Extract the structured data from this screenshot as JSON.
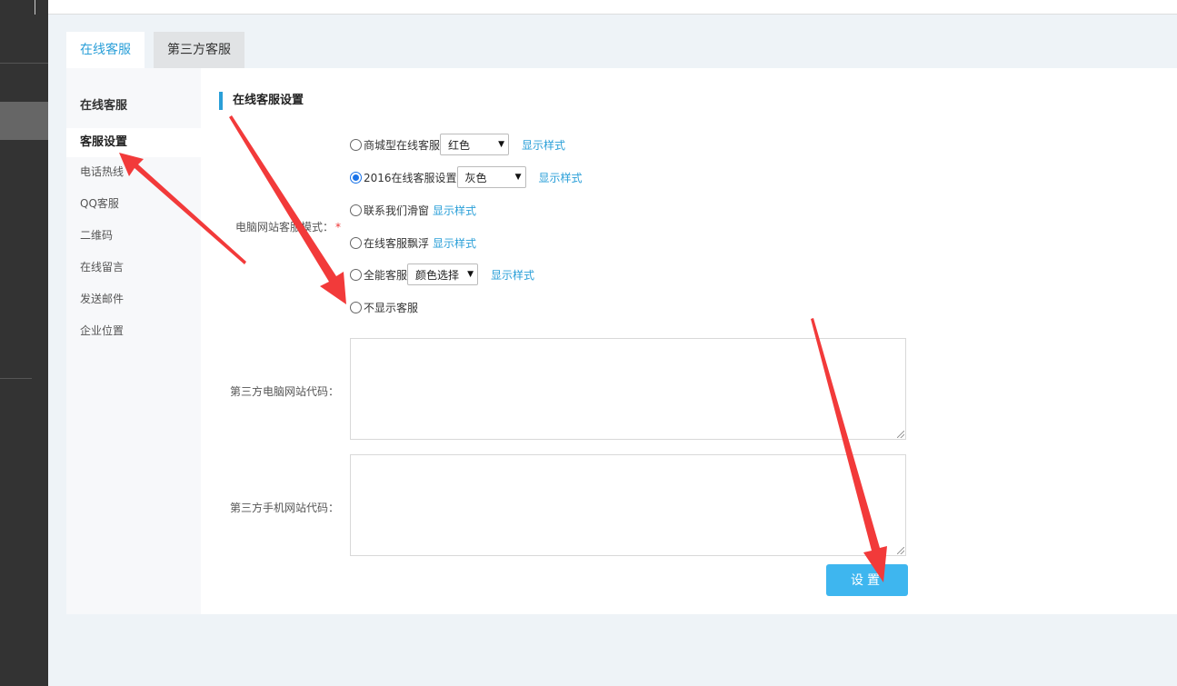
{
  "tabs": [
    {
      "label": "在线客服",
      "active": true
    },
    {
      "label": "第三方客服",
      "active": false
    }
  ],
  "sidenav": {
    "heading": "在线客服",
    "items": [
      {
        "label": "客服设置",
        "active": true
      },
      {
        "label": "电话热线",
        "active": false
      },
      {
        "label": "QQ客服",
        "active": false
      },
      {
        "label": "二维码",
        "active": false
      },
      {
        "label": "在线留言",
        "active": false
      },
      {
        "label": "发送邮件",
        "active": false
      },
      {
        "label": "企业位置",
        "active": false
      }
    ]
  },
  "form": {
    "section_title": "在线客服设置",
    "mode_label": "电脑网站客服模式：",
    "required_mark": "*",
    "options": [
      {
        "label": "商城型在线客服",
        "checked": false,
        "select": "红色",
        "link": "显示样式"
      },
      {
        "label": "2016在线客服设置",
        "checked": true,
        "select": "灰色",
        "link": "显示样式"
      },
      {
        "label": "联系我们滑窗",
        "checked": false,
        "link": "显示样式"
      },
      {
        "label": "在线客服飘浮",
        "checked": false,
        "link": "显示样式"
      },
      {
        "label": "全能客服",
        "checked": false,
        "select": "颜色选择",
        "link": "显示样式"
      },
      {
        "label": "不显示客服",
        "checked": false
      }
    ],
    "pc_code_label": "第三方电脑网站代码：",
    "pc_code_value": "",
    "mobile_code_label": "第三方手机网站代码：",
    "mobile_code_value": "",
    "submit_label": "设置"
  },
  "colors": {
    "accent": "#2a9fd8",
    "button": "#3eb6ef",
    "annotation_arrow": "#f23a3a",
    "sidebar_dark": "#333333"
  }
}
